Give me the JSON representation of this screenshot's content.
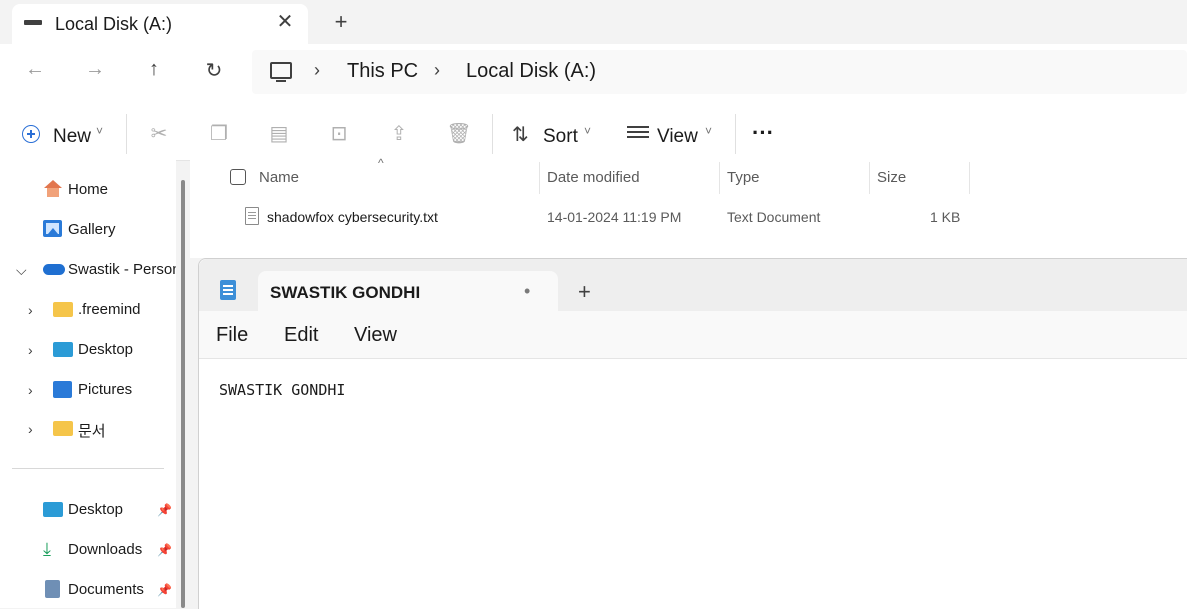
{
  "explorer": {
    "tab_title": "Local Disk (A:)",
    "tab_close": "✕",
    "new_tab": "+",
    "nav": {
      "back": "←",
      "forward": "→",
      "up": "↑",
      "refresh": "↻"
    },
    "breadcrumb": [
      "This PC",
      "Local Disk (A:)"
    ],
    "breadcrumb_sep": "›",
    "commands": {
      "new_label": "New",
      "sort_label": "Sort",
      "view_label": "View",
      "more": "···",
      "caret": "˅"
    },
    "sidebar": {
      "top": [
        {
          "label": "Home"
        },
        {
          "label": "Gallery"
        },
        {
          "label": "Swastik - Person"
        }
      ],
      "folders": [
        {
          "label": ".freemind"
        },
        {
          "label": "Desktop"
        },
        {
          "label": "Pictures"
        },
        {
          "label": "문서"
        }
      ],
      "quick": [
        {
          "label": "Desktop"
        },
        {
          "label": "Downloads"
        },
        {
          "label": "Documents"
        }
      ]
    },
    "columns": {
      "name": "Name",
      "date": "Date modified",
      "type": "Type",
      "size": "Size"
    },
    "files": [
      {
        "name": "shadowfox cybersecurity.txt",
        "date": "14-01-2024 11:19 PM",
        "type": "Text Document",
        "size": "1 KB"
      }
    ]
  },
  "notepad": {
    "tab_title": "SWASTIK GONDHI",
    "unsaved_dot": "•",
    "new_tab": "+",
    "menu": [
      "File",
      "Edit",
      "View"
    ],
    "content": "SWASTIK GONDHI"
  }
}
